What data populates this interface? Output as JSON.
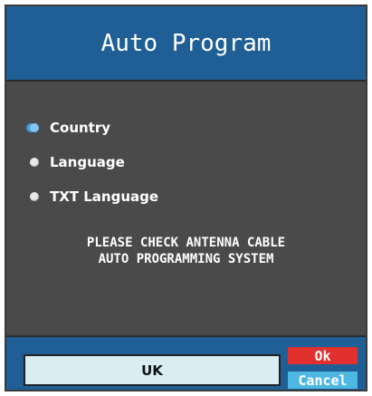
{
  "dialog": {
    "title": "Auto Program"
  },
  "menu": {
    "items": [
      {
        "label": "Country",
        "selected": true
      },
      {
        "label": "Language",
        "selected": false
      },
      {
        "label": "TXT Language",
        "selected": false
      }
    ]
  },
  "notice": {
    "line1": "PLEASE CHECK ANTENNA CABLE",
    "line2": "AUTO PROGRAMMING SYSTEM"
  },
  "footer": {
    "current_value": "UK",
    "ok_label": "Ok",
    "cancel_label": "Cancel"
  },
  "colors": {
    "header_blue": "#1f5f95",
    "panel_gray": "#4a4a4a",
    "ok_red": "#e2302f",
    "cancel_cyan": "#4fb7e3",
    "value_box_bg": "#d9eef3",
    "selected_bullet": "#7fc7ff"
  }
}
